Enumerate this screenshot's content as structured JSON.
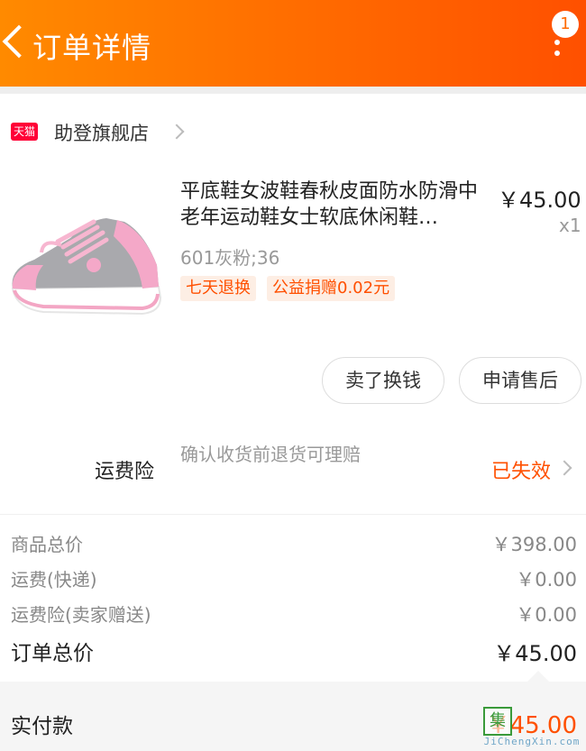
{
  "header": {
    "title": "订单详情",
    "badge_count": "1",
    "bg_color": "#ff6a00"
  },
  "shop": {
    "badge": "天猫",
    "name": "助登旗舰店"
  },
  "product": {
    "title": "平底鞋女波鞋春秋皮面防水防滑中老年运动鞋女士软底休闲鞋…",
    "price": "￥45.00",
    "quantity": "x1",
    "spec": "601灰粉;36",
    "tags": [
      "七天退换",
      "公益捐赠0.02元"
    ],
    "image_icon": "pink-gray-sneaker-image"
  },
  "actions": {
    "sell": "卖了换钱",
    "after_sale": "申请售后"
  },
  "insurance": {
    "label": "运费险",
    "desc": "确认收货前退货可理赔",
    "status": "已失效"
  },
  "summary": {
    "rows": [
      {
        "label": "商品总价",
        "value": "￥398.00"
      },
      {
        "label": "运费(快递)",
        "value": "￥0.00"
      },
      {
        "label": "运费险(卖家赠送)",
        "value": "￥0.00"
      }
    ],
    "total_label": "订单总价",
    "total_value": "￥45.00"
  },
  "payment": {
    "label": "实付款",
    "value": "￥45.00"
  },
  "watermark": {
    "char": "集",
    "text": "JiChengXin.com"
  },
  "colors": {
    "accent": "#ff5000",
    "tag_bg": "#fdeee4"
  }
}
